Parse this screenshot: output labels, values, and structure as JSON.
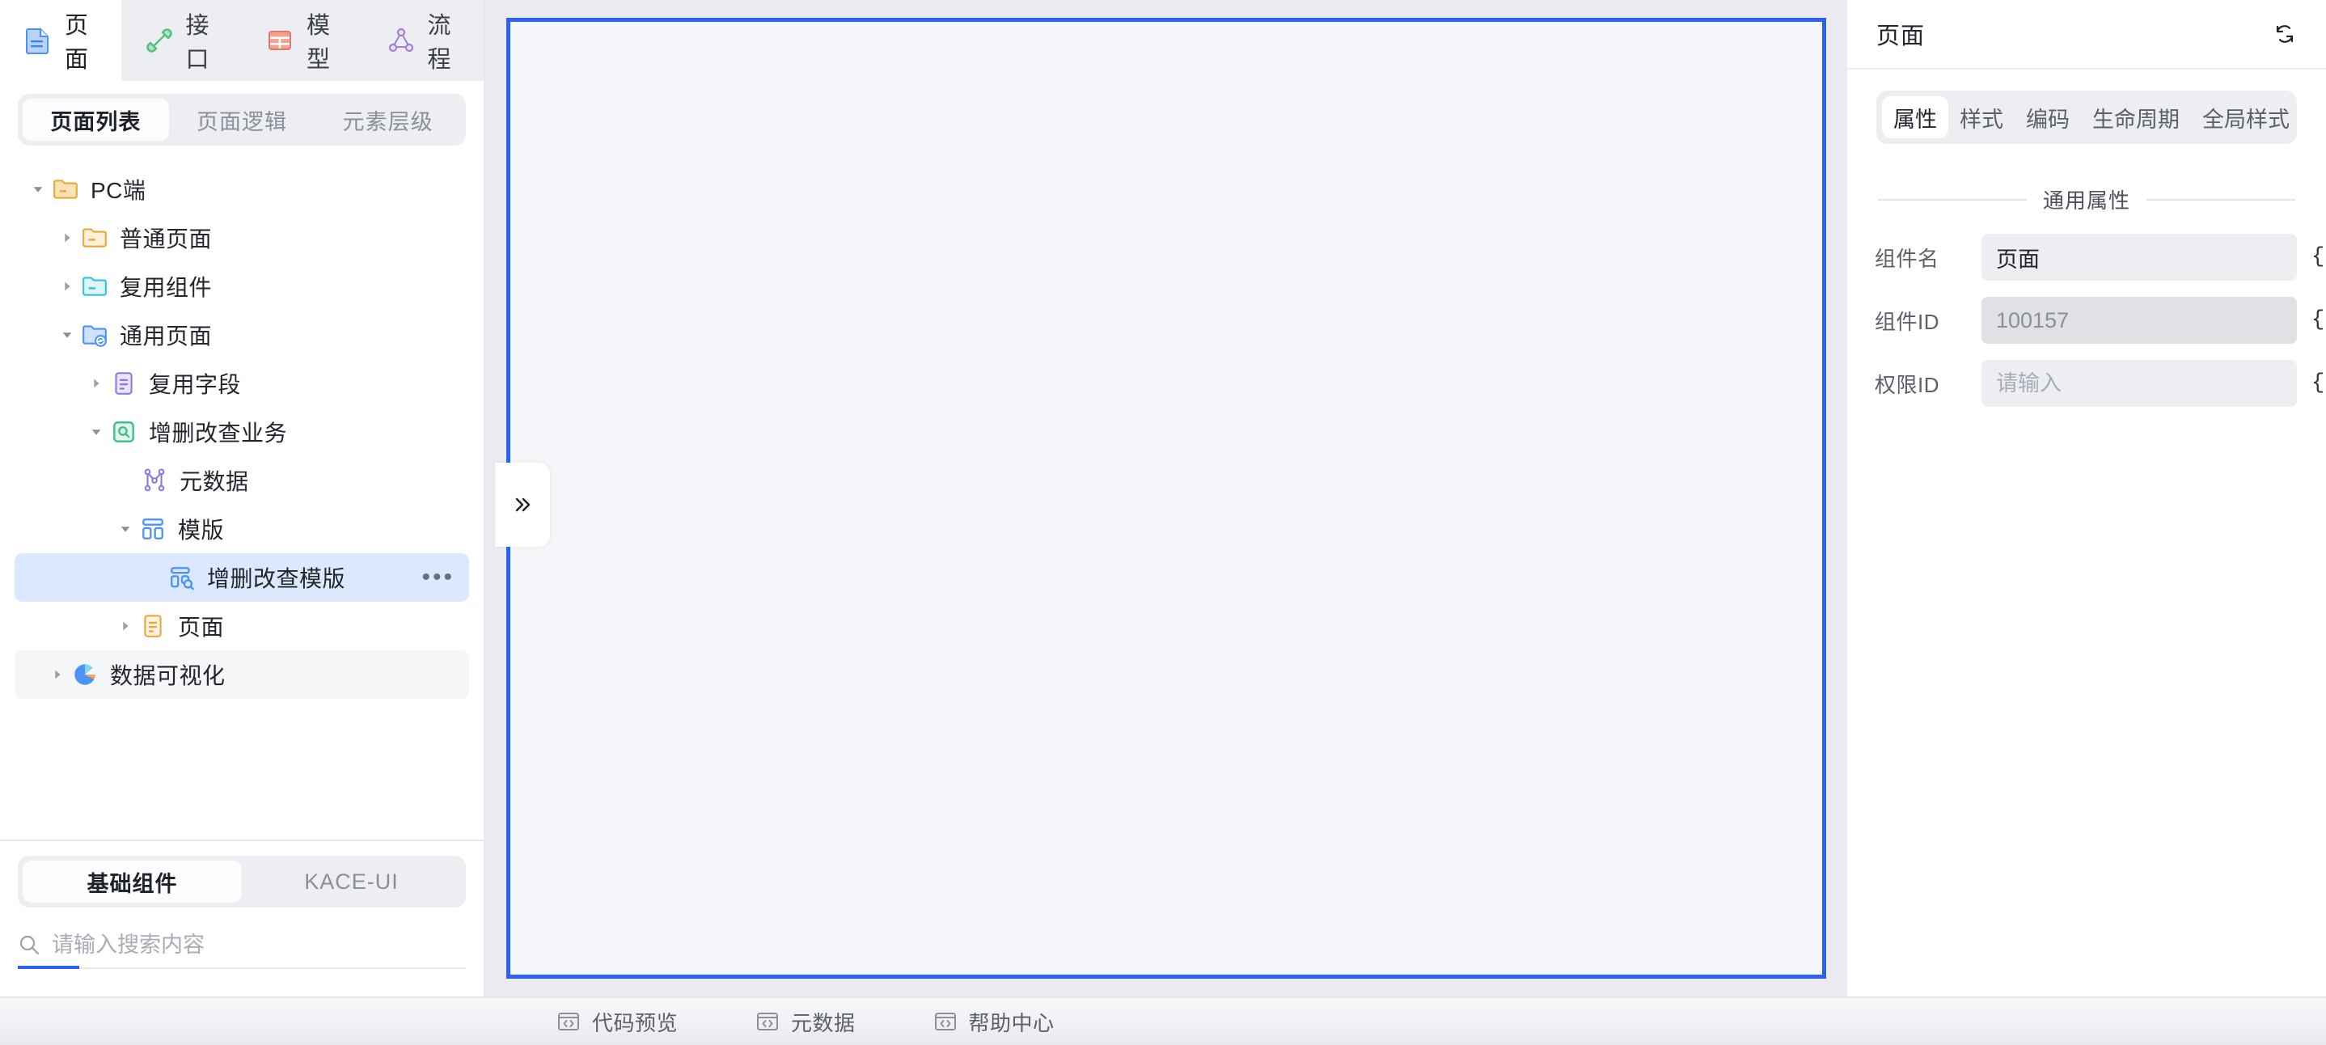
{
  "main_tabs": [
    {
      "label": "页面",
      "icon": "page-icon",
      "active": true
    },
    {
      "label": "接口",
      "icon": "api-plug-icon",
      "active": false
    },
    {
      "label": "模型",
      "icon": "model-table-icon",
      "active": false
    },
    {
      "label": "流程",
      "icon": "flow-graph-icon",
      "active": false
    }
  ],
  "sub_tabs": [
    {
      "label": "页面列表",
      "active": true
    },
    {
      "label": "页面逻辑",
      "active": false
    },
    {
      "label": "元素层级",
      "active": false
    }
  ],
  "tree": [
    {
      "label": "PC端",
      "icon": "folder-orange-icon",
      "depth": 0,
      "caret": "down",
      "state": "normal"
    },
    {
      "label": "普通页面",
      "icon": "folder-orange-icon",
      "depth": 1,
      "caret": "right",
      "state": "normal"
    },
    {
      "label": "复用组件",
      "icon": "folder-cyan-icon",
      "depth": 1,
      "caret": "right",
      "state": "normal"
    },
    {
      "label": "通用页面",
      "icon": "folder-sync-blue-icon",
      "depth": 1,
      "caret": "down",
      "state": "normal"
    },
    {
      "label": "复用字段",
      "icon": "doc-purple-icon",
      "depth": 2,
      "caret": "right",
      "state": "normal"
    },
    {
      "label": "增删改查业务",
      "icon": "search-box-green-icon",
      "depth": 2,
      "caret": "down",
      "state": "normal"
    },
    {
      "label": "元数据",
      "icon": "metadata-node-icon",
      "depth": 3,
      "caret": "none",
      "state": "normal"
    },
    {
      "label": "模版",
      "icon": "template-blue-icon",
      "depth": 3,
      "caret": "down",
      "state": "normal"
    },
    {
      "label": "增删改查模版",
      "icon": "template-search-blue-icon",
      "depth": 4,
      "caret": "none",
      "state": "selected",
      "more": "•••"
    },
    {
      "label": "页面",
      "icon": "doc-orange-icon",
      "depth": 3,
      "caret": "right",
      "state": "normal"
    },
    {
      "label": "数据可视化",
      "icon": "pie-chart-icon",
      "depth": 1,
      "caret": "right",
      "state": "hovered"
    }
  ],
  "component_panel": {
    "tabs": [
      {
        "label": "基础组件",
        "active": true
      },
      {
        "label": "KACE-UI",
        "active": false
      }
    ],
    "search": {
      "placeholder": "请输入搜索内容",
      "value": "",
      "icon": "search-icon"
    }
  },
  "canvas": {
    "border_color": "#2a63f0",
    "fill_color": "#f3f5f8",
    "surround_color": "#eaebf0",
    "collapse_handle_icon": "chevron-double-right-icon"
  },
  "right_panel": {
    "title": "页面",
    "refresh_icon": "refresh-icon",
    "tabs": [
      {
        "label": "属性",
        "active": true
      },
      {
        "label": "样式",
        "active": false
      },
      {
        "label": "编码",
        "active": false
      },
      {
        "label": "生命周期",
        "active": false
      },
      {
        "label": "全局样式",
        "active": false
      }
    ],
    "section_title": "通用属性",
    "properties": [
      {
        "label": "组件名",
        "value": "页面",
        "placeholder": "",
        "disabled": false,
        "expr": "{/}"
      },
      {
        "label": "组件ID",
        "value": "100157",
        "placeholder": "",
        "disabled": true,
        "expr": "{/}"
      },
      {
        "label": "权限ID",
        "value": "",
        "placeholder": "请输入",
        "disabled": false,
        "expr": "{/}"
      }
    ]
  },
  "bottom_bar": [
    {
      "label": "代码预览",
      "icon": "code-window-icon"
    },
    {
      "label": "元数据",
      "icon": "code-window-icon"
    },
    {
      "label": "帮助中心",
      "icon": "code-window-icon"
    }
  ]
}
